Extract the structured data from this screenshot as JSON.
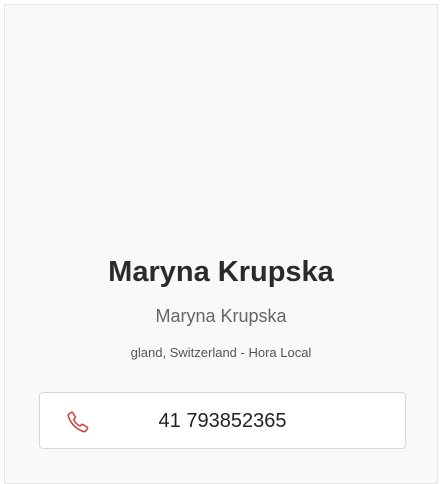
{
  "profile": {
    "name": "Maryna Krupska",
    "subtitle": "Maryna Krupska",
    "location": "gland, Switzerland - Hora Local"
  },
  "contact": {
    "phone": "41 793852365",
    "icon": "phone-icon",
    "icon_color": "#d23b3b"
  }
}
